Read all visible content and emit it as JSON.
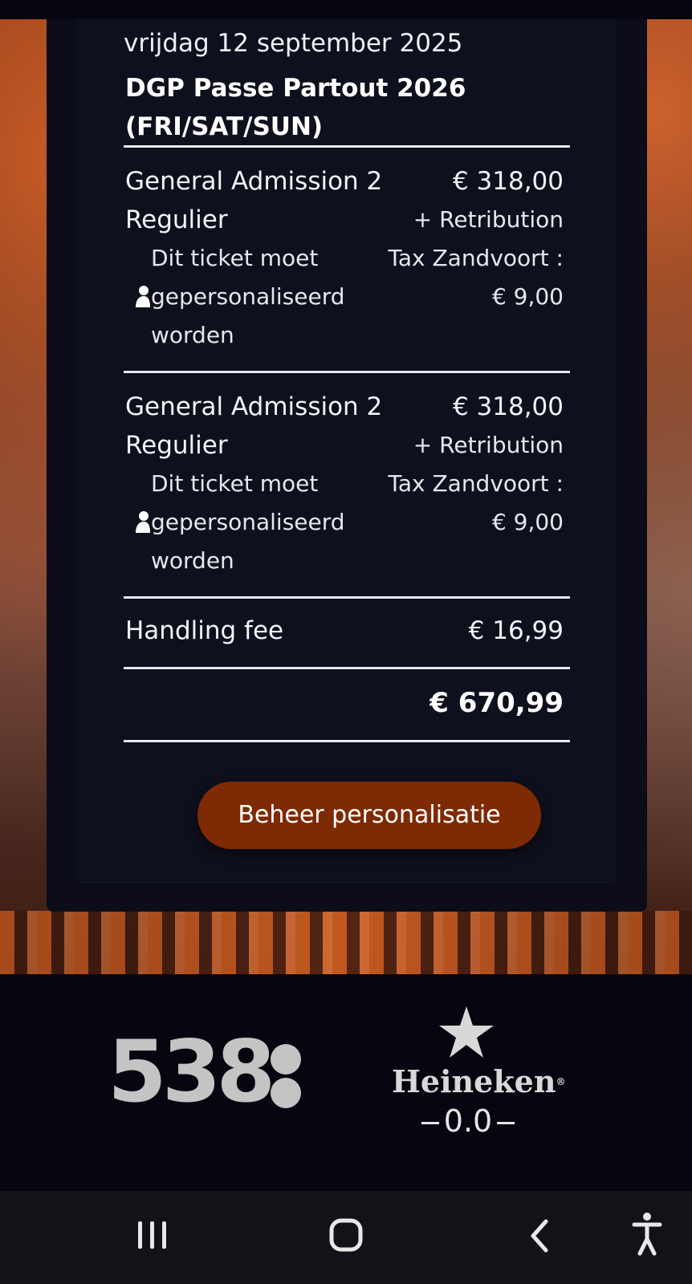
{
  "order": {
    "date": "vrijdag 12 september 2025",
    "event_title": "DGP Passe Partout 2026 (FRI/SAT/SUN)",
    "tickets": [
      {
        "name": "General Admission 2 Regulier",
        "price": "€ 318,00",
        "tax_note": "+ Retribution Tax Zandvoort : € 9,00",
        "personalization_note": "Dit ticket moet gepersonaliseerd worden",
        "icon": "person-icon"
      },
      {
        "name": "General Admission 2 Regulier",
        "price": "€ 318,00",
        "tax_note": "+ Retribution Tax Zandvoort : € 9,00",
        "personalization_note": "Dit ticket moet gepersonaliseerd worden",
        "icon": "person-icon"
      }
    ],
    "handling_fee_label": "Handling fee",
    "handling_fee_value": "€ 16,99",
    "total": "€ 670,99",
    "manage_button_label": "Beheer personalisatie"
  },
  "sponsors": {
    "radio_538": "538",
    "heineken_name": "Heineken",
    "heineken_registered": "®",
    "heineken_variant": "0.0"
  },
  "navbar": {
    "icons": [
      "recent-apps-icon",
      "home-icon",
      "back-icon",
      "accessibility-icon"
    ]
  },
  "colors": {
    "background": "#05060f",
    "panel": "#0f101d",
    "accent_button": "#7d2a05",
    "text": "#ffffff",
    "logo_gray": "#c4c4c4"
  }
}
